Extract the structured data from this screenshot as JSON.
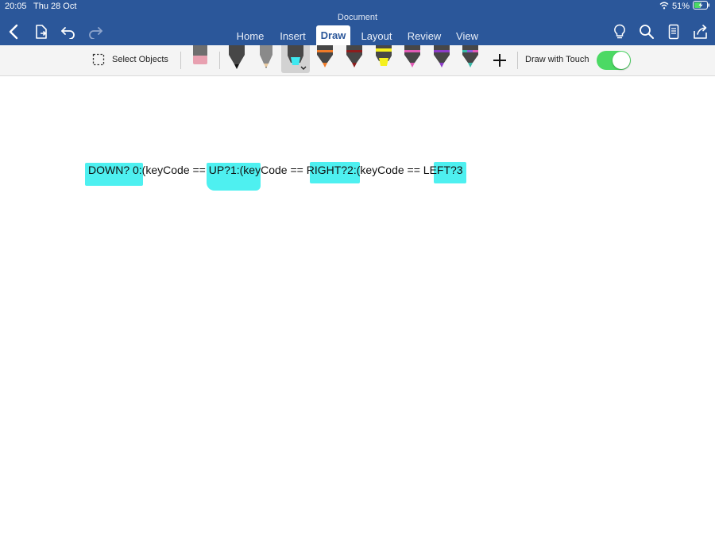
{
  "status_bar": {
    "time": "20:05",
    "date": "Thu 28 Oct",
    "battery": "51%"
  },
  "title_bar": {
    "document_title": "Document"
  },
  "tabs": [
    {
      "label": "Home"
    },
    {
      "label": "Insert"
    },
    {
      "label": "Draw",
      "active": true
    },
    {
      "label": "Layout"
    },
    {
      "label": "Review"
    },
    {
      "label": "View"
    }
  ],
  "ribbon": {
    "select_objects_label": "Select Objects",
    "draw_with_touch_label": "Draw with Touch",
    "draw_with_touch_on": true,
    "tools": [
      {
        "name": "eraser",
        "color": "#e8a0b0"
      },
      {
        "name": "black pen",
        "color": "#111111"
      },
      {
        "name": "pencil",
        "color": "#8a8a8a"
      },
      {
        "name": "cyan highlighter",
        "color": "#3ee8f0",
        "selected": true
      },
      {
        "name": "orange pen",
        "color": "#f07a28"
      },
      {
        "name": "dark red pen",
        "color": "#8c1c1c"
      },
      {
        "name": "yellow highlighter",
        "color": "#f5f01e"
      },
      {
        "name": "pink pen",
        "color": "#e05ab4"
      },
      {
        "name": "purple pen",
        "color": "#8c3cc8"
      },
      {
        "name": "galaxy pen",
        "color": "#38b8a8"
      }
    ]
  },
  "document": {
    "code_segments": [
      "DOWN? 0",
      ":(keyCode == ",
      "UP?1:(ke",
      "yCode == ",
      "RIGHT?2",
      ":(keyCode == L",
      "EFT?3"
    ]
  },
  "colors": {
    "header": "#2b579a",
    "highlight": "#4ef0f0",
    "toggle_on": "#4cd964"
  }
}
